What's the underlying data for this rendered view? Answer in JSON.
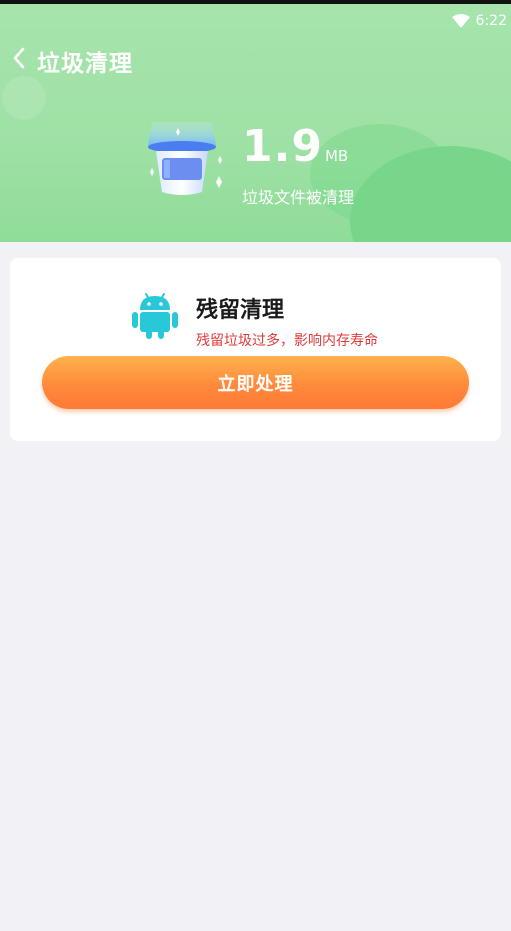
{
  "status_bar": {
    "time": "6:22",
    "wifi_icon": "wifi-icon"
  },
  "header": {
    "title": "垃圾清理",
    "back_icon": "chevron-left-icon",
    "cleaned_size": "1.9",
    "cleaned_unit": "MB",
    "cleaned_label": "垃圾文件被清理",
    "background_color": "#a6e4ac"
  },
  "card": {
    "icon": "android-icon",
    "title": "残留清理",
    "description": "残留垃圾过多，影响内存寿命",
    "description_color": "#e03a3a",
    "action_label": "立即处理",
    "action_color": "#ff8a3c"
  }
}
